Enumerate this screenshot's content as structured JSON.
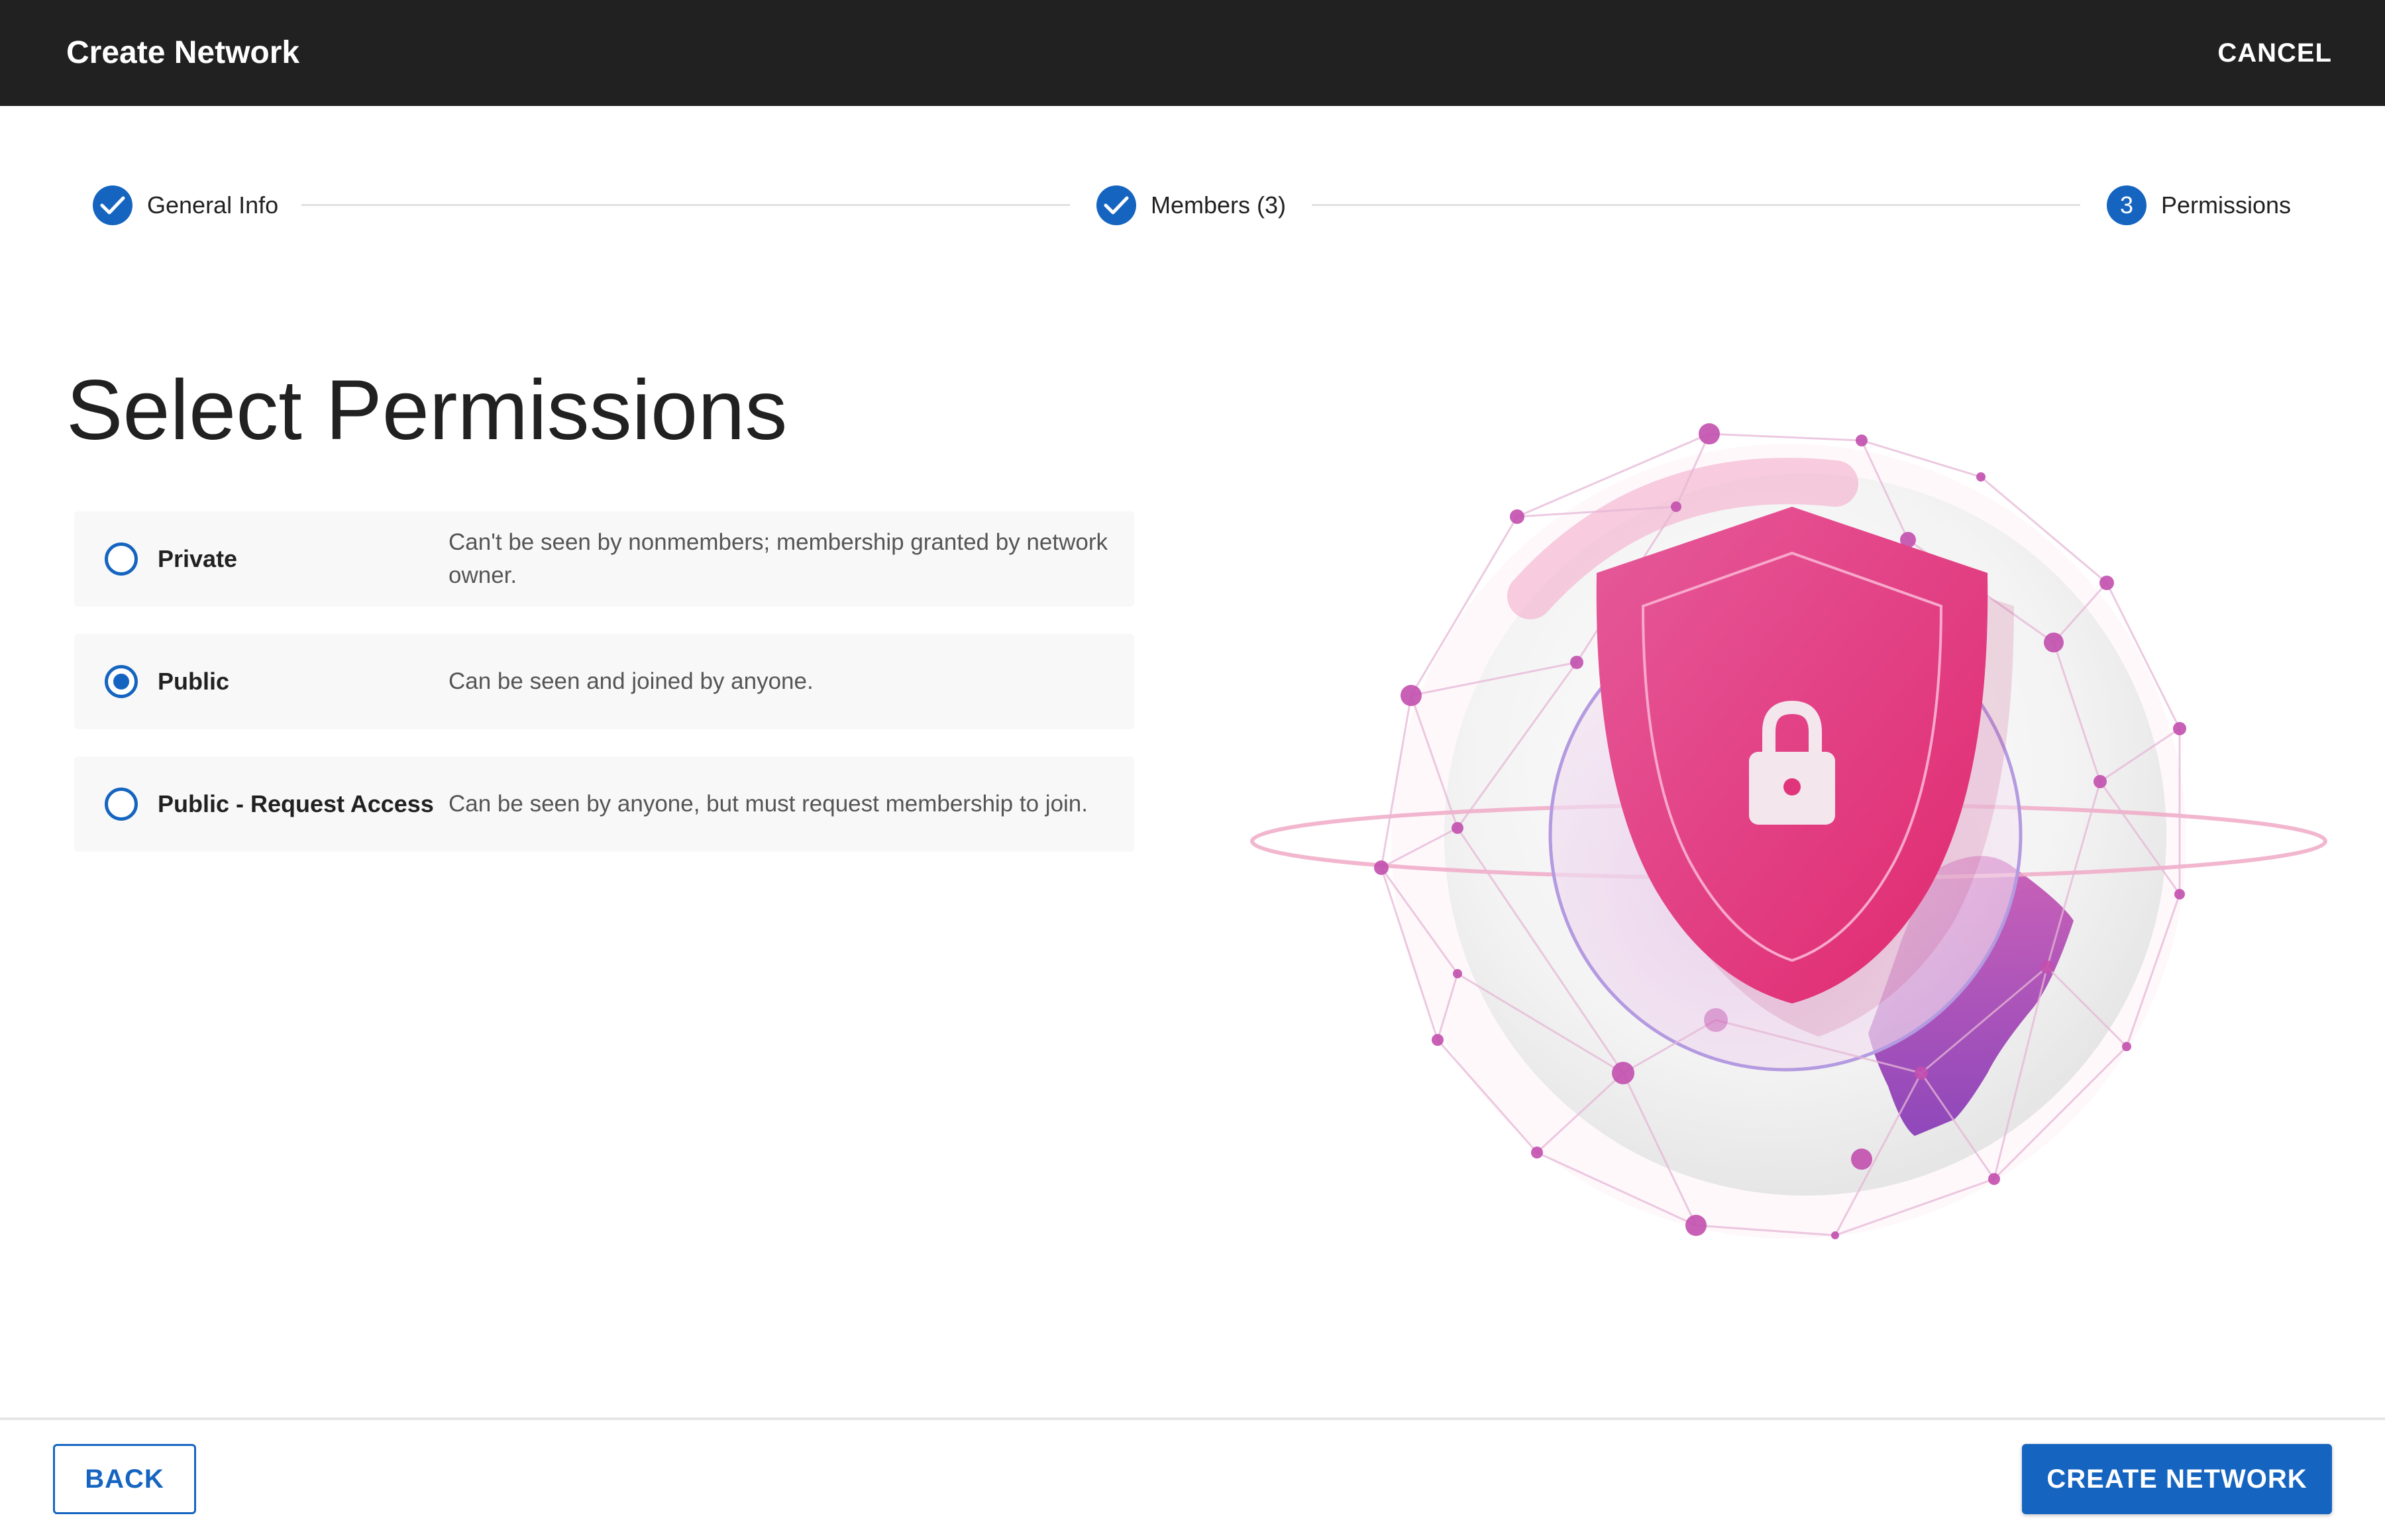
{
  "app_bar": {
    "title": "Create Network",
    "cancel_label": "CANCEL"
  },
  "stepper": {
    "steps": [
      {
        "label": "General Info",
        "state": "completed",
        "icon": "check-icon"
      },
      {
        "label": "Members (3)",
        "state": "completed",
        "icon": "check-icon"
      },
      {
        "label": "Permissions",
        "state": "active",
        "number": "3"
      }
    ]
  },
  "main": {
    "heading": "Select Permissions",
    "options": [
      {
        "label": "Private",
        "description": "Can't be seen by nonmembers; membership granted by network owner.",
        "selected": false
      },
      {
        "label": "Public",
        "description": "Can be seen and joined by anyone.",
        "selected": true
      },
      {
        "label": "Public - Request Access",
        "description": "Can be seen by anyone, but must request membership to join.",
        "selected": false
      }
    ]
  },
  "illustration": {
    "icon": "shield-lock-globe-illustration"
  },
  "footer": {
    "back_label": "BACK",
    "create_label": "CREATE NETWORK"
  },
  "colors": {
    "primary": "#1565c0",
    "app_bar": "#212121",
    "shield": "#e0357a"
  }
}
